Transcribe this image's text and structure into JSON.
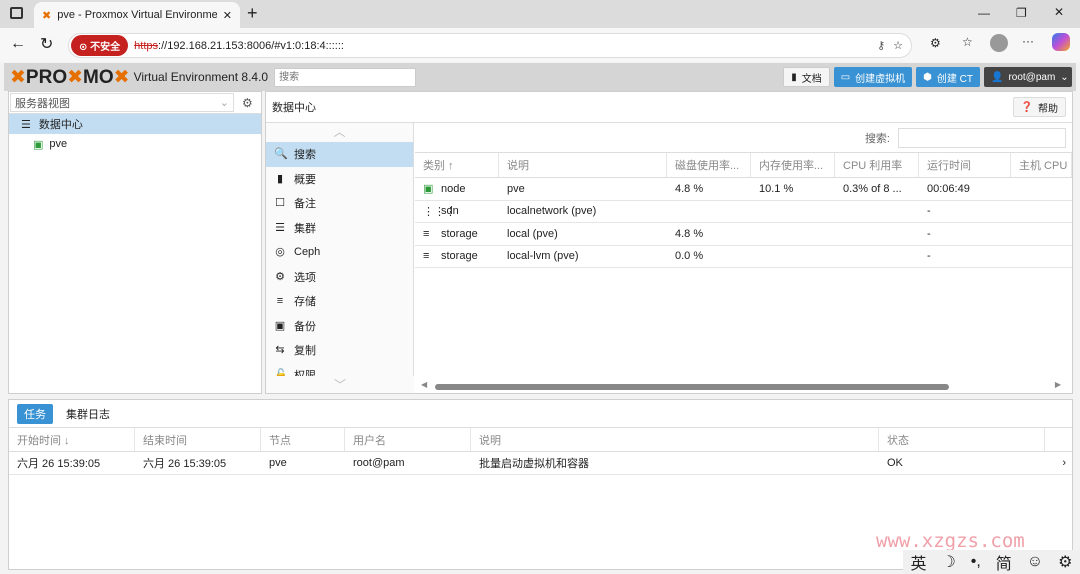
{
  "browser": {
    "tab_title": "pve - Proxmox Virtual Environmen",
    "insecure_label": "不安全",
    "url_scheme": "https",
    "url_rest": "://192.168.21.153:8006/#v1:0:18:4::::::"
  },
  "header": {
    "logo": "PROXMOX",
    "product": "Virtual Environment 8.4.0",
    "search_placeholder": "搜索",
    "docs": "文档",
    "create_vm": "创建虚拟机",
    "create_ct": "创建 CT",
    "user": "root@pam"
  },
  "tree": {
    "view": "服务器视图",
    "items": [
      {
        "label": "数据中心"
      },
      {
        "label": "pve"
      }
    ]
  },
  "content": {
    "title": "数据中心",
    "help": "帮助",
    "search_label": "搜索:"
  },
  "nav": [
    {
      "label": "搜索",
      "icon": "search-icon"
    },
    {
      "label": "概要",
      "icon": "book-icon"
    },
    {
      "label": "备注",
      "icon": "note-icon"
    },
    {
      "label": "集群",
      "icon": "server-icon"
    },
    {
      "label": "Ceph",
      "icon": "ceph-icon"
    },
    {
      "label": "选项",
      "icon": "gear-icon"
    },
    {
      "label": "存储",
      "icon": "database-icon"
    },
    {
      "label": "备份",
      "icon": "floppy-icon"
    },
    {
      "label": "复制",
      "icon": "retweet-icon"
    },
    {
      "label": "权限",
      "icon": "unlock-icon"
    }
  ],
  "grid": {
    "columns": [
      "类别 ↑",
      "说明",
      "磁盘使用率...",
      "内存使用率...",
      "CPU 利用率",
      "运行时间",
      "主机 CPU"
    ],
    "rows": [
      {
        "type": "node",
        "desc": "pve",
        "disk": "4.8 %",
        "mem": "10.1 %",
        "cpu": "0.3% of 8 ...",
        "uptime": "00:06:49"
      },
      {
        "type": "sdn",
        "desc": "localnetwork (pve)",
        "disk": "",
        "mem": "",
        "cpu": "",
        "uptime": "-"
      },
      {
        "type": "storage",
        "desc": "local (pve)",
        "disk": "4.8 %",
        "mem": "",
        "cpu": "",
        "uptime": "-"
      },
      {
        "type": "storage",
        "desc": "local-lvm (pve)",
        "disk": "0.0 %",
        "mem": "",
        "cpu": "",
        "uptime": "-"
      }
    ]
  },
  "bottom": {
    "tabs": [
      "任务",
      "集群日志"
    ],
    "columns": [
      "开始时间 ↓",
      "结束时间",
      "节点",
      "用户名",
      "说明",
      "状态"
    ],
    "rows": [
      {
        "start": "六月 26 15:39:05",
        "end": "六月 26 15:39:05",
        "node": "pve",
        "user": "root@pam",
        "desc": "批量启动虚拟机和容器",
        "status": "OK"
      }
    ]
  },
  "watermark": "www.xzgzs.com",
  "ime": [
    "英",
    "☽",
    "•,",
    "简",
    "☺",
    "⚙"
  ],
  "colors": {
    "accent": "#3892d4",
    "selected": "#c2ddf2",
    "orange": "#e57000"
  }
}
